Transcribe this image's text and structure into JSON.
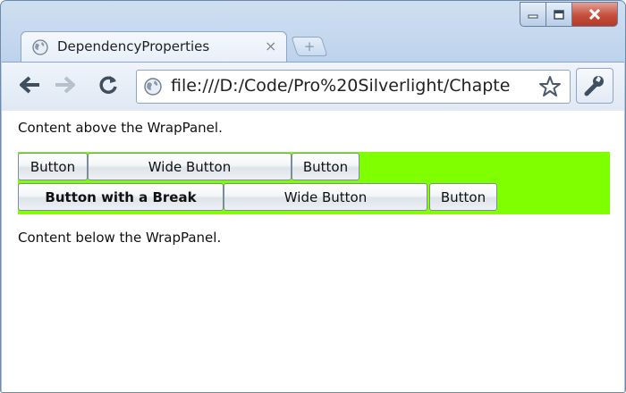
{
  "browser": {
    "tab_title": "DependencyProperties",
    "tab_close": "×",
    "new_tab": "+",
    "url": "file:///D:/Code/Pro%20Silverlight/Chapte",
    "window_controls": {
      "minimize_icon": "minimize-icon",
      "maximize_icon": "maximize-icon",
      "close_icon": "close-icon"
    }
  },
  "page": {
    "text_above": "Content above the WrapPanel.",
    "text_below": "Content below the WrapPanel.",
    "wrap_panel_background": "#80ff00",
    "row1": [
      {
        "label": "Button"
      },
      {
        "label": "Wide Button"
      },
      {
        "label": "Button"
      }
    ],
    "row2": [
      {
        "label": "Button with a Break",
        "bold": true
      },
      {
        "label": "Wide Button"
      },
      {
        "label": "Button"
      }
    ]
  }
}
